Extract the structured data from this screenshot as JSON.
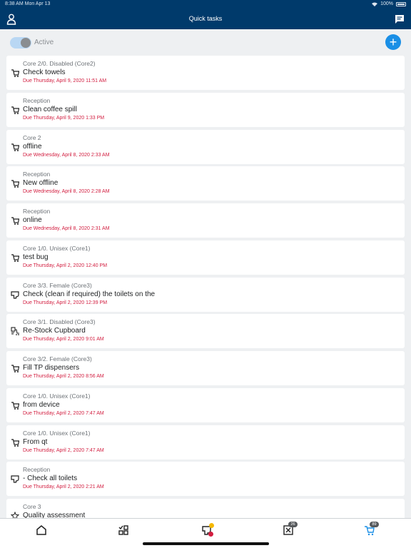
{
  "status_bar": {
    "time": "8:38 AM  Mon Apr 13",
    "battery": "100%"
  },
  "header": {
    "title": "Quick tasks",
    "left_icon": "user-icon",
    "right_icon": "chat-icon"
  },
  "filter": {
    "toggle_label": "Active",
    "toggle_on": true,
    "add_icon": "plus-icon",
    "add_label": "+"
  },
  "tasks": [
    {
      "location": "Core 2/0. Disabled (Core2)",
      "name": "Check towels",
      "due": "Due Thursday, April 9, 2020 11:51 AM",
      "icon": "cart-icon"
    },
    {
      "location": "Reception",
      "name": "Clean coffee spill",
      "due": "Due Thursday, April 9, 2020 1:33 PM",
      "icon": "cart-icon"
    },
    {
      "location": "Core 2",
      "name": "offline",
      "due": "Due Wednesday, April 8, 2020 2:33 AM",
      "icon": "cart-icon"
    },
    {
      "location": "Reception",
      "name": "New offline",
      "due": "Due Wednesday, April 8, 2020 2:28 AM",
      "icon": "cart-icon"
    },
    {
      "location": "Reception",
      "name": "online",
      "due": "Due Wednesday, April 8, 2020 2:31 AM",
      "icon": "cart-icon"
    },
    {
      "location": "Core 1/0. Unisex (Core1)",
      "name": "test bug",
      "due": "Due Thursday, April 2, 2020 12:40 PM",
      "icon": "cart-icon"
    },
    {
      "location": "Core 3/3. Female (Core3)",
      "name": "Check (clean if required) the toilets on the",
      "due": "Due Thursday, April 2, 2020 12:39 PM",
      "icon": "toilet-icon"
    },
    {
      "location": "Core 3/1. Disabled (Core3)",
      "name": "Re-Stock Cupboard",
      "due": "Due Thursday, April 2, 2020 9:01 AM",
      "icon": "restock-icon"
    },
    {
      "location": "Core 3/2. Female (Core3)",
      "name": "Fill TP dispensers",
      "due": "Due Thursday, April 2, 2020 8:56 AM",
      "icon": "cart-icon"
    },
    {
      "location": "Core 1/0. Unisex (Core1)",
      "name": "from device",
      "due": "Due Thursday, April 2, 2020 7:47 AM",
      "icon": "cart-icon"
    },
    {
      "location": "Core 1/0. Unisex (Core1)",
      "name": "From qt",
      "due": "Due Thursday, April 2, 2020 7:47 AM",
      "icon": "cart-icon"
    },
    {
      "location": "Reception",
      "name": "- Check all toilets",
      "due": "Due Thursday, April 2, 2020 2:21 AM",
      "icon": "toilet-icon"
    },
    {
      "location": "Core 3",
      "name": "Quality assessment",
      "due": "",
      "icon": "star-icon"
    }
  ],
  "bottom_nav": [
    {
      "icon": "home-icon",
      "badge": ""
    },
    {
      "icon": "checklist-icon",
      "badge": ""
    },
    {
      "icon": "toilet-alert-icon",
      "badge": ""
    },
    {
      "icon": "close-box-icon",
      "badge": "26"
    },
    {
      "icon": "cart-icon",
      "badge": "89"
    }
  ],
  "colors": {
    "header": "#003a6b",
    "accent": "#1a8fe6",
    "due": "#d21d3f",
    "alert_yellow": "#f5b800",
    "alert_red": "#d21d3f"
  }
}
